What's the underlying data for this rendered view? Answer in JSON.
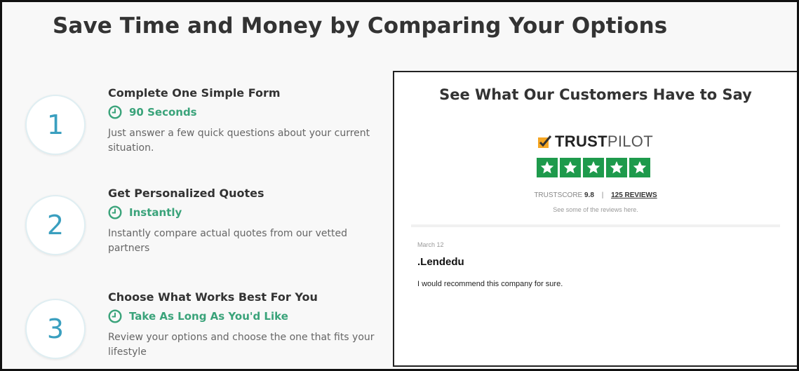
{
  "main": {
    "title": "Save Time and Money by Comparing Your Options"
  },
  "steps": [
    {
      "number": "1",
      "title": "Complete One Simple Form",
      "time": "90 Seconds",
      "description": "Just answer a few quick questions about your current situation."
    },
    {
      "number": "2",
      "title": "Get Personalized Quotes",
      "time": "Instantly",
      "description": "Instantly compare actual quotes from our vetted partners"
    },
    {
      "number": "3",
      "title": "Choose What Works Best For You",
      "time": "Take As Long As You'd Like",
      "description": "Review your options and choose the one that fits your lifestyle"
    }
  ],
  "reviews": {
    "title": "See What Our Customers Have to Say",
    "logo_text_bold": "TRUST",
    "logo_text_light": "PILOT",
    "star_count": 5,
    "trustscore_label": "TRUSTSCORE",
    "trustscore_value": "9.8",
    "separator": "|",
    "reviews_link": "125 REVIEWS",
    "subtext": "See some of the reviews here.",
    "items": [
      {
        "date": "March 12",
        "author": ".Lendedu",
        "text": "I would recommend this company for sure."
      }
    ]
  },
  "colors": {
    "accent_green": "#3aa37a",
    "step_number_blue": "#3a9fbf",
    "trustpilot_green": "#1e9a4c",
    "trustpilot_orange": "#f5a623"
  },
  "icons": {
    "clock": "clock-icon",
    "trustpilot_check": "trustpilot-check-icon",
    "star": "star-icon"
  }
}
